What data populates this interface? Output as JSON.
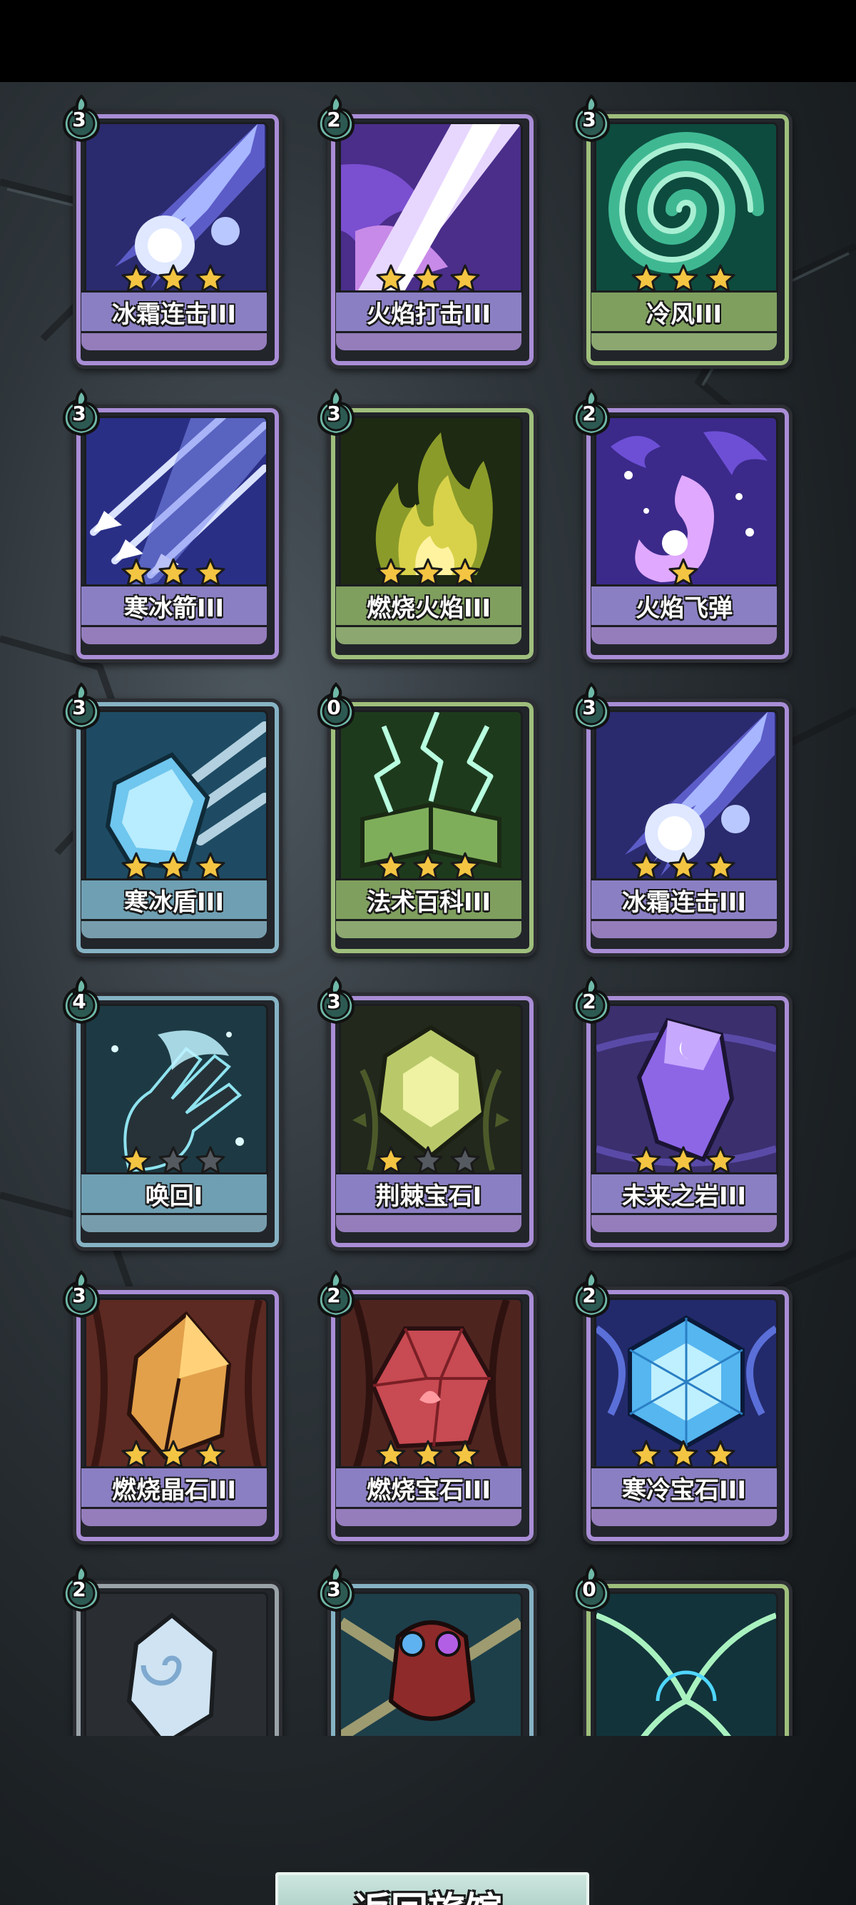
{
  "screen": {
    "return_button": {
      "label": "返回旅馆"
    }
  },
  "colors": {
    "purple_rim": "#a98dd6",
    "purple_bar": "#8b7fc4",
    "green_rim": "#9fbf7c",
    "green_bar": "#7f9f5e",
    "blue_rim": "#86b3c4",
    "blue_bar": "#6f9fb2",
    "gray_rim": "#9aa3a8",
    "star_gold": "#f4c542",
    "star_empty": "#555a60"
  },
  "cards": [
    {
      "cost": "3",
      "name": "冰霜连击III",
      "stars": 3,
      "max_stars": 3,
      "theme": "purple",
      "art": "ice-comet"
    },
    {
      "cost": "2",
      "name": "火焰打击III",
      "stars": 3,
      "max_stars": 3,
      "theme": "purple",
      "art": "flame-slash"
    },
    {
      "cost": "3",
      "name": "冷风III",
      "stars": 3,
      "max_stars": 3,
      "theme": "green",
      "art": "whirlwind"
    },
    {
      "cost": "3",
      "name": "寒冰箭III",
      "stars": 3,
      "max_stars": 3,
      "theme": "purple",
      "art": "ice-arrows"
    },
    {
      "cost": "3",
      "name": "燃烧火焰III",
      "stars": 3,
      "max_stars": 3,
      "theme": "green",
      "art": "bonfire"
    },
    {
      "cost": "2",
      "name": "火焰飞弹",
      "stars": 1,
      "max_stars": 1,
      "theme": "purple",
      "art": "fire-missile"
    },
    {
      "cost": "3",
      "name": "寒冰盾III",
      "stars": 3,
      "max_stars": 3,
      "theme": "blue",
      "art": "ice-shield"
    },
    {
      "cost": "0",
      "name": "法术百科III",
      "stars": 3,
      "max_stars": 3,
      "theme": "green",
      "art": "spellbook"
    },
    {
      "cost": "3",
      "name": "冰霜连击III",
      "stars": 3,
      "max_stars": 3,
      "theme": "purple",
      "art": "ice-comet"
    },
    {
      "cost": "4",
      "name": "唤回I",
      "stars": 1,
      "max_stars": 3,
      "theme": "blue",
      "art": "recall-hand"
    },
    {
      "cost": "3",
      "name": "荆棘宝石I",
      "stars": 1,
      "max_stars": 3,
      "theme": "purple",
      "art": "thorn-gem"
    },
    {
      "cost": "2",
      "name": "未来之岩III",
      "stars": 3,
      "max_stars": 3,
      "theme": "purple",
      "art": "future-rock"
    },
    {
      "cost": "3",
      "name": "燃烧晶石III",
      "stars": 3,
      "max_stars": 3,
      "theme": "purple",
      "art": "burning-crystal"
    },
    {
      "cost": "2",
      "name": "燃烧宝石III",
      "stars": 3,
      "max_stars": 3,
      "theme": "purple",
      "art": "burning-gem"
    },
    {
      "cost": "2",
      "name": "寒冷宝石III",
      "stars": 3,
      "max_stars": 3,
      "theme": "purple",
      "art": "cold-gem"
    },
    {
      "cost": "2",
      "name": "",
      "stars": 0,
      "max_stars": 0,
      "theme": "gray",
      "art": "wind-stone"
    },
    {
      "cost": "3",
      "name": "",
      "stars": 0,
      "max_stars": 0,
      "theme": "blue",
      "art": "power-gauntlet"
    },
    {
      "cost": "0",
      "name": "",
      "stars": 0,
      "max_stars": 0,
      "theme": "green",
      "art": "lightning-web"
    }
  ]
}
